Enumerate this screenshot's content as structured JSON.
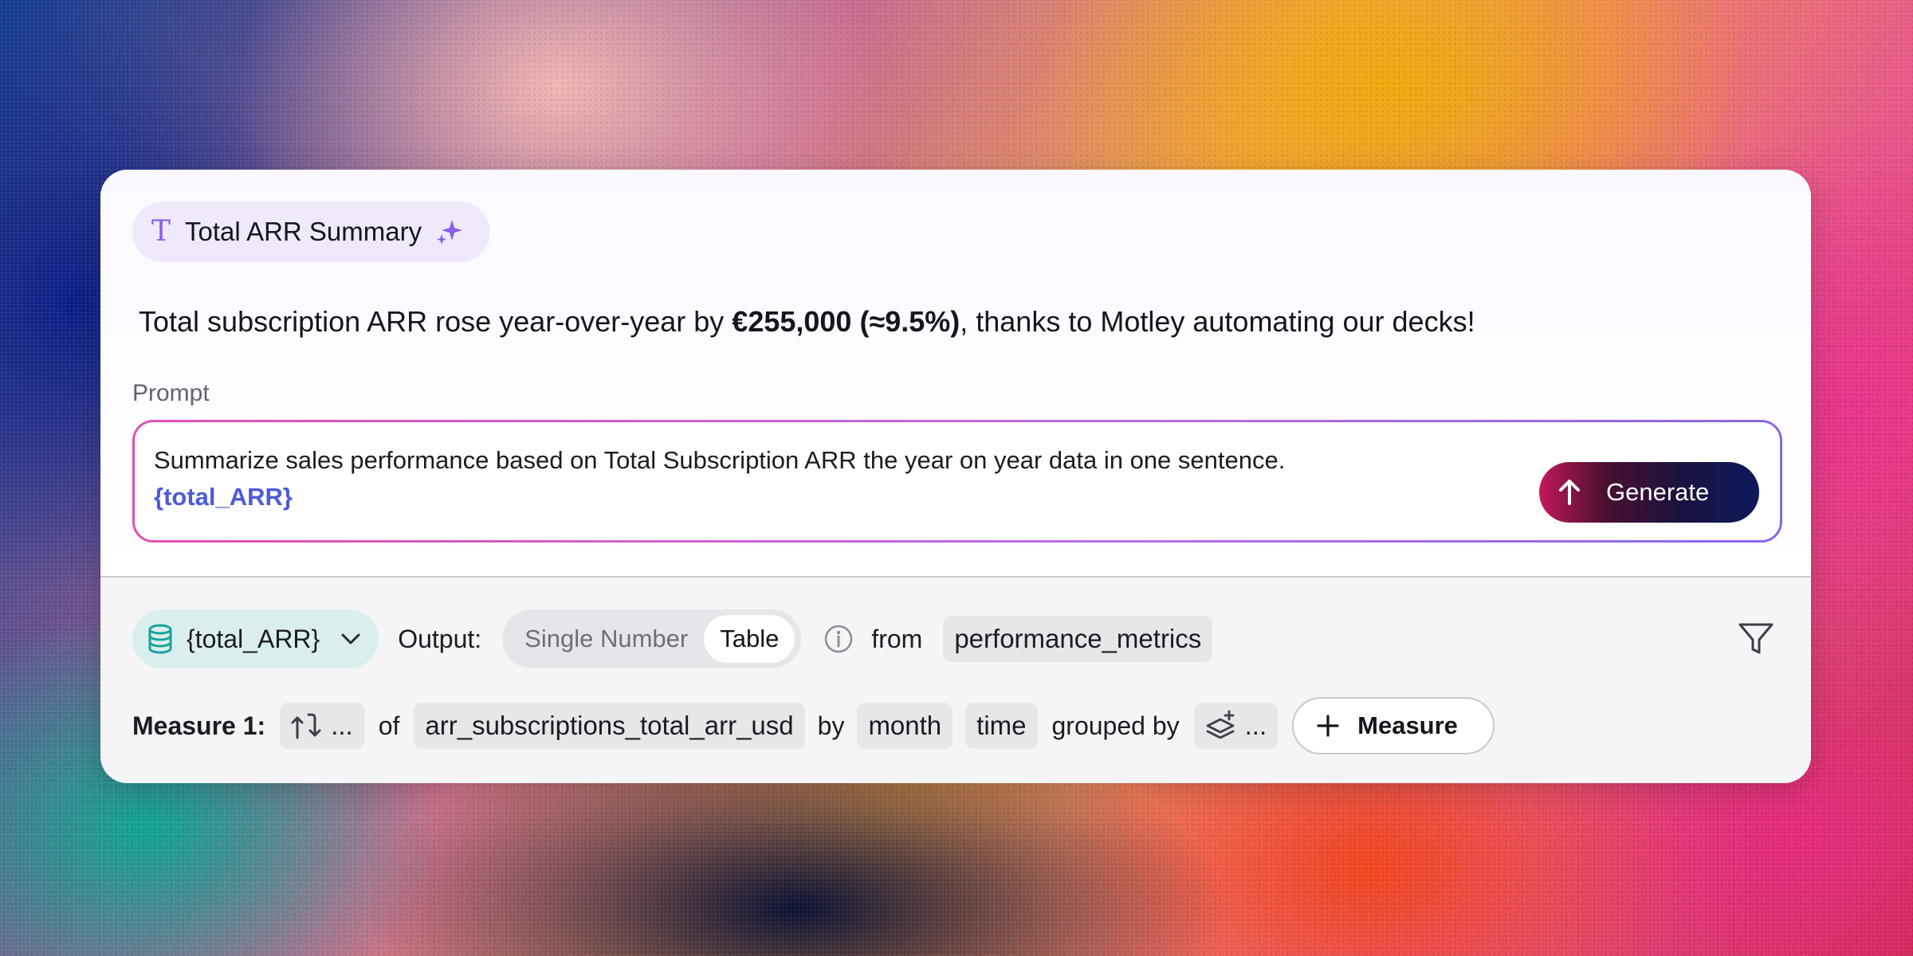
{
  "card": {
    "title": "Total ARR Summary",
    "summary": {
      "part1": "Total subscription ARR rose year-over-year by ",
      "bold": "€255,000 (≈9.5%)",
      "part2": ", thanks to Motley automating our decks!"
    },
    "prompt_label": "Prompt",
    "prompt": {
      "text": "Summarize sales performance based on Total Subscription ARR the year on year data in one sentence.",
      "variable": "{total_ARR}"
    },
    "generate_label": "Generate"
  },
  "query": {
    "dataset_label": "{total_ARR}",
    "output_label": "Output:",
    "output_options": [
      "Single Number",
      "Table"
    ],
    "output_selected": "Table",
    "from_label": "from",
    "table": "performance_metrics",
    "measure_label": "Measure 1:",
    "aggregation": "...",
    "of_label": "of",
    "column": "arr_subscriptions_total_arr_usd",
    "by_label": "by",
    "granularity": "month",
    "time_field": "time",
    "grouped_by_label": "grouped by",
    "group_value": "...",
    "add_measure_label": "Measure"
  },
  "icons": [
    "text-type-icon",
    "sparkle-icon",
    "arrow-up-icon",
    "database-icon",
    "chevron-down-icon",
    "info-icon",
    "filter-icon",
    "aggregation-icon",
    "layers-plus-icon",
    "plus-icon"
  ],
  "colors": {
    "accent_purple": "#8a5cf0",
    "variable_blue": "#4d5bd6",
    "dataset_chip_bg": "#dbeeee",
    "dataset_icon": "#17a398"
  }
}
